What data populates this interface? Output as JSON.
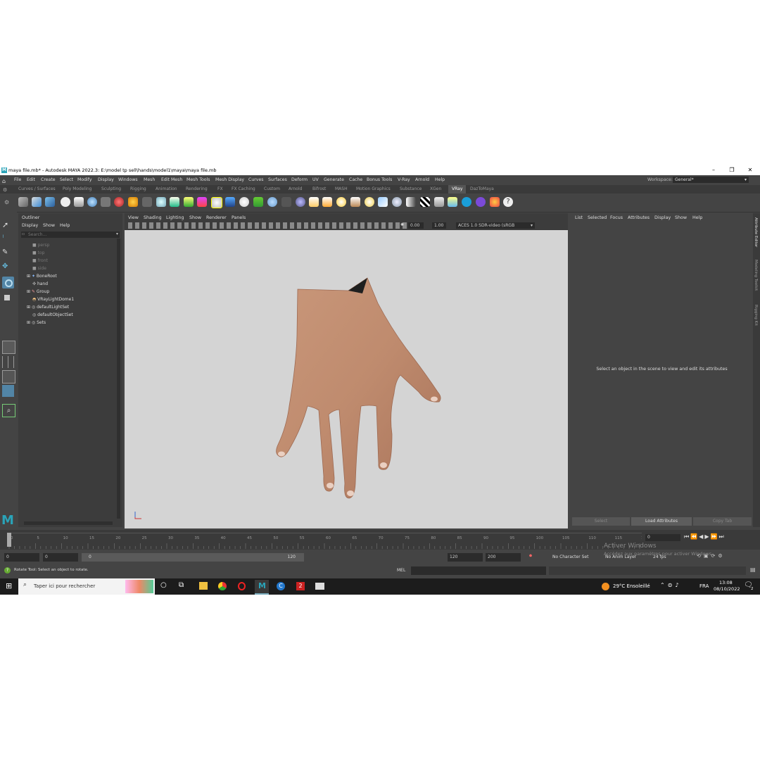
{
  "window": {
    "title": "maya file.mb* - Autodesk MAYA 2022.3: E:\\model tp sell\\hands\\model1\\maya\\maya file.mb"
  },
  "menu": [
    "File",
    "Edit",
    "Create",
    "Select",
    "Modify",
    "Display",
    "Windows",
    "Mesh",
    "Edit Mesh",
    "Mesh Tools",
    "Mesh Display",
    "Curves",
    "Surfaces",
    "Deform",
    "UV",
    "Generate",
    "Cache",
    "Bonus Tools",
    "V-Ray",
    "Arnold",
    "Help"
  ],
  "workspace": {
    "label": "Workspace:",
    "value": "General*"
  },
  "shelf_tabs": [
    "Curves / Surfaces",
    "Poly Modeling",
    "Sculpting",
    "Rigging",
    "Animation",
    "Rendering",
    "FX",
    "FX Caching",
    "Custom",
    "Arnold",
    "Bifrost",
    "MASH",
    "Motion Graphics",
    "Substance",
    "XGen",
    "VRay",
    "DazToMaya"
  ],
  "shelf_active": "VRay",
  "outliner": {
    "title": "Outliner",
    "menu": [
      "Display",
      "Show",
      "Help"
    ],
    "search_placeholder": "Search...",
    "items": [
      "persp",
      "top",
      "front",
      "side",
      "BoneRoot",
      "hand",
      "Group",
      "VRayLightDome1",
      "defaultLightSet",
      "defaultObjectSet",
      "Sets"
    ]
  },
  "viewport": {
    "menu": [
      "View",
      "Shading",
      "Lighting",
      "Show",
      "Renderer",
      "Panels"
    ],
    "exposure": "0.00",
    "gamma": "1.00",
    "colorspace": "ACES 1.0 SDR-video (sRGB"
  },
  "attribute_editor": {
    "menu": [
      "List",
      "Selected",
      "Focus",
      "Attributes",
      "Display",
      "Show",
      "Help"
    ],
    "message": "Select an object in the scene to view and edit its attributes",
    "buttons": [
      "Select",
      "Load Attributes",
      "Copy Tab"
    ],
    "side_tabs": [
      "Attribute Editor",
      "Modeling Toolkit",
      "Rigging Kit"
    ]
  },
  "timeline": {
    "ticks": [
      "0",
      "5",
      "10",
      "15",
      "20",
      "25",
      "30",
      "35",
      "40",
      "45",
      "50",
      "55",
      "60",
      "65",
      "70",
      "75",
      "80",
      "85",
      "90",
      "95",
      "100",
      "105",
      "110",
      "115",
      "120"
    ],
    "current_frame": "0"
  },
  "range": {
    "start": "0",
    "anim_start": "0",
    "slider_start": "0",
    "slider_end": "120",
    "end": "120",
    "anim_end": "200",
    "character_set": "No Character Set",
    "anim_layer": "No Anim Layer",
    "fps": "24 fps"
  },
  "watermark": {
    "line1": "Activer Windows",
    "line2": "Accédez aux paramètres pour activer Windows."
  },
  "status": {
    "help": "Rotate Tool: Select an object to rotate.",
    "cmd_label": "MEL"
  },
  "taskbar": {
    "search": "Taper ici pour rechercher",
    "weather": "29°C  Ensoleillé",
    "lang": "FRA",
    "time": "13:08",
    "date": "08/10/2022",
    "notif": "2"
  },
  "colors": {
    "maya_bg": "#444444",
    "viewport_bg": "#d4d4d4",
    "accent": "#5285a6",
    "skin": "#c18f72"
  }
}
